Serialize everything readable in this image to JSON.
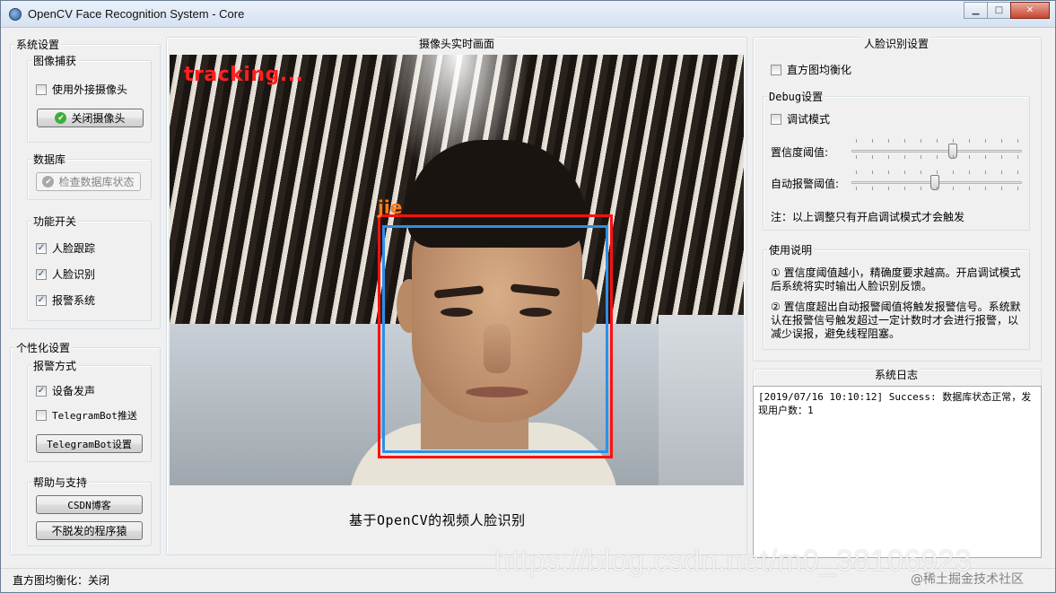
{
  "window": {
    "title": "OpenCV Face Recognition System - Core",
    "minimize": "▁",
    "maximize": "□",
    "close": "✕"
  },
  "left": {
    "system_settings": "系统设置",
    "capture": {
      "title": "图像捕获",
      "external_camera_label": "使用外接摄像头",
      "external_camera_checked": false,
      "close_camera_button": "关闭摄像头"
    },
    "database": {
      "title": "数据库",
      "check_button": "检查数据库状态"
    },
    "features": {
      "title": "功能开关",
      "items": [
        {
          "label": "人脸跟踪",
          "checked": true
        },
        {
          "label": "人脸识别",
          "checked": true
        },
        {
          "label": "报警系统",
          "checked": true
        }
      ]
    },
    "personal_settings": "个性化设置",
    "alarm": {
      "title": "报警方式",
      "device_sound": {
        "label": "设备发声",
        "checked": true
      },
      "telegram_push": {
        "label": "TelegramBot推送",
        "checked": false
      },
      "telegram_settings_button": "TelegramBot设置"
    },
    "help": {
      "title": "帮助与支持",
      "csdn_button": "CSDN博客",
      "programmer_button": "不脱发的程序猿"
    }
  },
  "center": {
    "title": "摄像头实时画面",
    "tracking_text": "tracking...",
    "face_label": "jie",
    "caption": "基于OpenCV的视频人脸识别"
  },
  "right": {
    "title": "人脸识别设置",
    "histogram_eq": {
      "label": "直方图均衡化",
      "checked": false
    },
    "debug": {
      "title": "Debug设置",
      "debug_mode": {
        "label": "调试模式",
        "checked": false
      },
      "confidence_label": "置信度阈值:",
      "confidence_level": 0.6,
      "alarm_label": "自动报警阈值:",
      "alarm_level": 0.49,
      "note": "注：以上调整只有开启调试模式才会触发"
    },
    "usage": {
      "title": "使用说明",
      "p1": "① 置信度阈值越小，精确度要求越高。开启调试模式后系统将实时输出人脸识别反馈。",
      "p2": "② 置信度超出自动报警阈值将触发报警信号。系统默认在报警信号触发超过一定计数时才会进行报警，以减少误报，避免线程阻塞。"
    },
    "log": {
      "title": "系统日志",
      "text": "[2019/07/16 10:10:12] Success: 数据库状态正常，发现用户数：1"
    }
  },
  "status": {
    "text": "直方图均衡化：关闭"
  },
  "watermark": {
    "url": "https://blog.csdn.net/m0_38106923",
    "community": "@稀土掘金技术社区"
  },
  "colors": {
    "tracking": "#ff2020",
    "face_box_outer": "#ff1010",
    "face_box_inner": "#2e8fe6",
    "face_label": "#ff7a1a",
    "ok_icon": "#3cae3c"
  }
}
